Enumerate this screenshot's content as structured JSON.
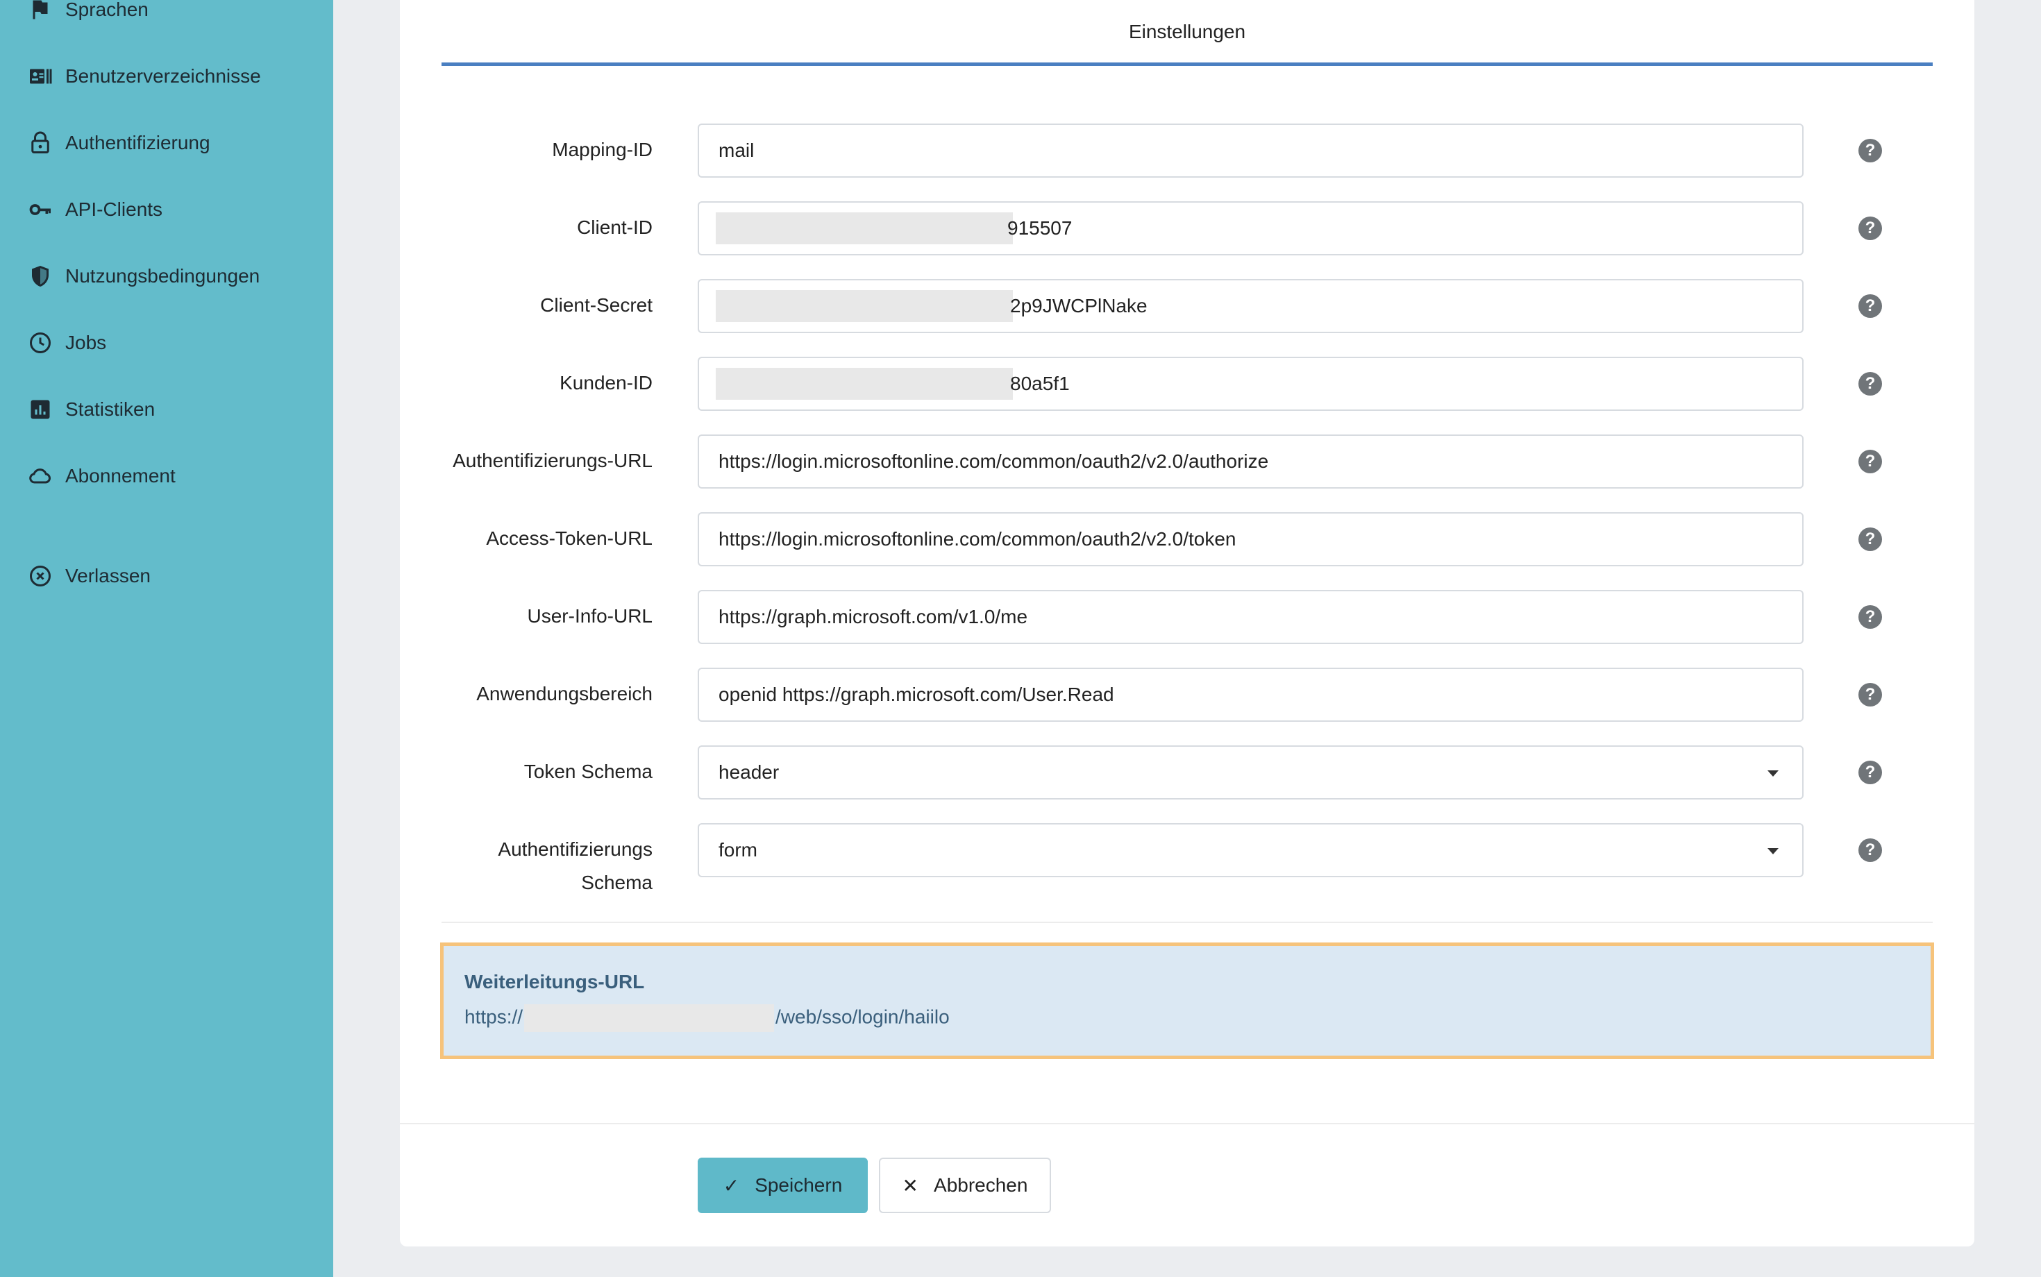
{
  "sidebar": {
    "items": [
      {
        "label": "Sprachen",
        "icon": "flag-icon"
      },
      {
        "label": "Benutzerverzeichnisse",
        "icon": "directory-icon"
      },
      {
        "label": "Authentifizierung",
        "icon": "lock-icon"
      },
      {
        "label": "API-Clients",
        "icon": "key-icon"
      },
      {
        "label": "Nutzungsbedingungen",
        "icon": "shield-icon"
      },
      {
        "label": "Jobs",
        "icon": "clock-icon"
      },
      {
        "label": "Statistiken",
        "icon": "chart-icon"
      },
      {
        "label": "Abonnement",
        "icon": "cloud-icon"
      },
      {
        "label": "Verlassen",
        "icon": "close-circle-icon"
      }
    ]
  },
  "main": {
    "tab": "Einstellungen",
    "fields": [
      {
        "label": "Mapping-ID",
        "value": "mail"
      },
      {
        "label": "Client-ID",
        "value": "915507"
      },
      {
        "label": "Client-Secret",
        "value": "2p9JWCPlNake"
      },
      {
        "label": "Kunden-ID",
        "value": "80a5f1"
      },
      {
        "label": "Authentifizierungs-URL",
        "value": "https://login.microsoftonline.com/common/oauth2/v2.0/authorize"
      },
      {
        "label": "Access-Token-URL",
        "value": "https://login.microsoftonline.com/common/oauth2/v2.0/token"
      },
      {
        "label": "User-Info-URL",
        "value": "https://graph.microsoft.com/v1.0/me"
      },
      {
        "label": "Anwendungsbereich",
        "value": "openid https://graph.microsoft.com/User.Read"
      },
      {
        "label": "Token Schema",
        "value": "header"
      },
      {
        "label": "Authentifizierungs",
        "label2": "Schema",
        "value": "form"
      }
    ],
    "redirect": {
      "title": "Weiterleitungs-URL",
      "prefix": "https://",
      "suffix": "/web/sso/login/haiilo"
    },
    "help_glyph": "?",
    "buttons": {
      "save": "Speichern",
      "save_icon": "✓",
      "cancel": "Abbrechen",
      "cancel_icon": "✕"
    }
  },
  "colors": {
    "sidebar": "#63bccb",
    "accent": "#4a7fc1",
    "highlight_border": "#f6c37b",
    "info_bg": "#dbe8f3"
  }
}
